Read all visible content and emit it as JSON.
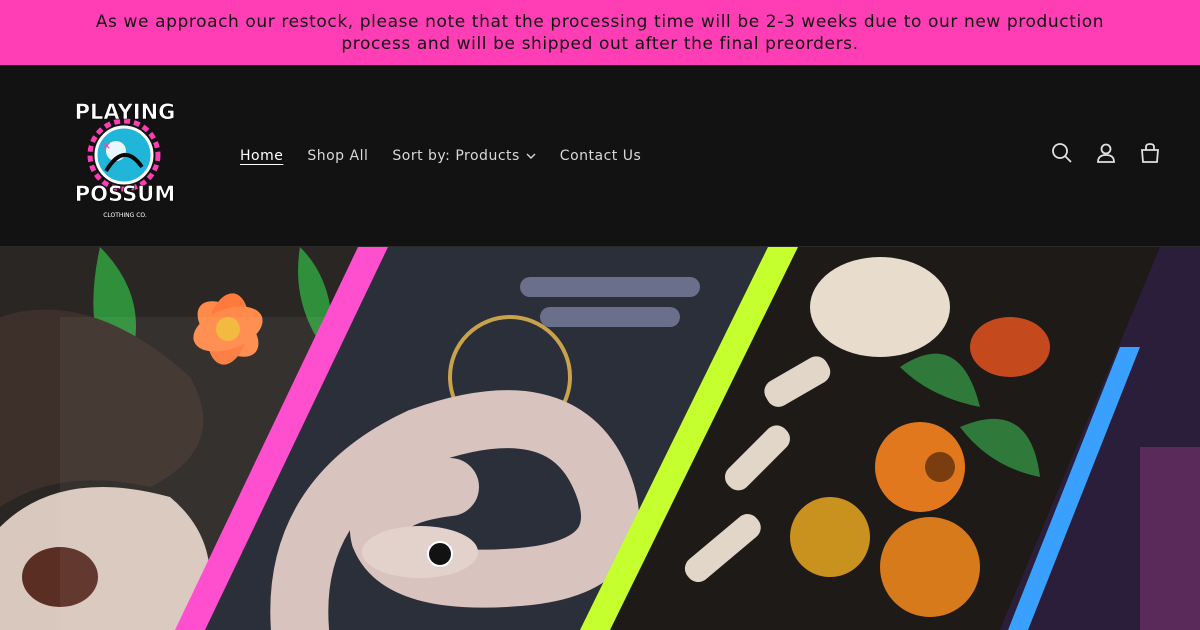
{
  "announcement": {
    "text": "As we approach our restock, please note that the processing time will be 2-3 weeks due to our new production process and will be shipped out after the final preorders."
  },
  "logo": {
    "line1": "PLAYING",
    "line2": "POSSUM",
    "line3": "CLOTHING CO."
  },
  "nav": {
    "home": "Home",
    "shop_all": "Shop All",
    "sort_by": "Sort by: Products",
    "contact": "Contact Us"
  },
  "icons": {
    "search": "search-icon",
    "account": "account-icon",
    "cart": "cart-icon"
  },
  "colors": {
    "announcement_bg": "#ff3db4",
    "header_bg": "#121212",
    "stripe_pink": "#ff4fcf",
    "stripe_lime": "#c6ff2e",
    "stripe_blue": "#3aa0ff"
  }
}
